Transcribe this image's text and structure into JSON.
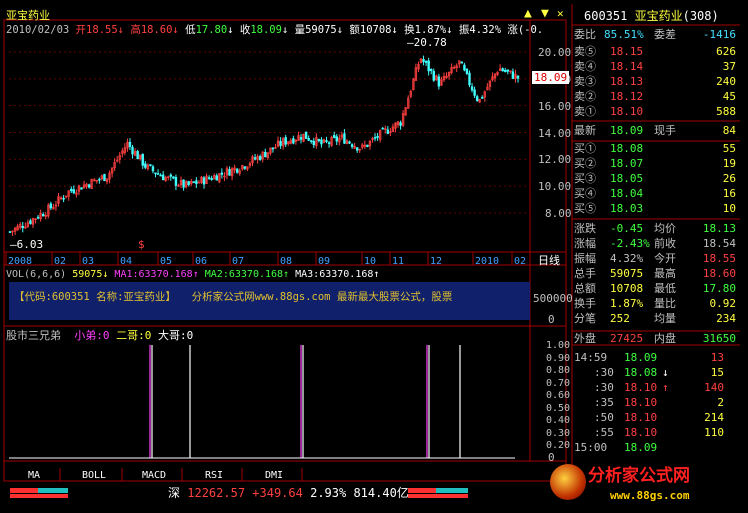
{
  "header": {
    "name": "亚宝药业",
    "date": "2010/02/03",
    "open_lbl": "开",
    "open": "18.55",
    "high_lbl": "高",
    "high": "18.60",
    "low_lbl": "低",
    "low": "17.80",
    "close_lbl": "收",
    "close": "18.09",
    "vol_lbl": "量",
    "vol": "59075",
    "amt_lbl": "额",
    "amt": "10708",
    "turn_lbl": "换",
    "turn": "1.87%",
    "amp_lbl": "振",
    "amp": "4.32%",
    "chg_lbl": "涨",
    "chg": "(-0."
  },
  "price_chart": {
    "y_ticks": [
      "20.00",
      "18.00",
      "16.00",
      "14.00",
      "12.00",
      "10.00",
      "8.00"
    ],
    "current_price": "18.09",
    "max_label": "20.78",
    "min_label": "6.03",
    "x_ticks": [
      "2008",
      "02",
      "03",
      "04",
      "05",
      "06",
      "07",
      "08",
      "09",
      "10",
      "11",
      "12",
      "2010",
      "02"
    ],
    "period": "日线",
    "marker": "$",
    "chart_data": {
      "type": "candlestick",
      "title": "亚宝药业",
      "period": "日线",
      "ylim": [
        6,
        21.5
      ],
      "max": 20.78,
      "min": 6.03,
      "last": 18.09,
      "trend_close": [
        6.6,
        7.4,
        8.3,
        9.6,
        10.2,
        10.8,
        13.2,
        11.4,
        10.6,
        10.0,
        10.5,
        11.0,
        11.6,
        12.4,
        13.3,
        13.8,
        13.1,
        13.6,
        12.8,
        13.9,
        14.8,
        19.6,
        17.6,
        19.2,
        16.3,
        18.8,
        18.09
      ]
    }
  },
  "vol_chart": {
    "title": "VOL(6,6,6)",
    "v": "59075",
    "ma1_lbl": "MA1:",
    "ma1": "63370.168",
    "ma2_lbl": "MA2:",
    "ma2": "63370.168",
    "ma3_lbl": "MA3:",
    "ma3": "63370.168",
    "tick": "500000",
    "zero": "0",
    "watermark": "【代码:600351 名称:亚宝药业】　　分析家公式网www.88gs.com 最新最大股票公式，股票"
  },
  "ind_chart": {
    "title": "股市三兄弟",
    "s1_lbl": "小弟:",
    "s1": "0",
    "s2_lbl": "二哥:",
    "s2": "0",
    "s3_lbl": "大哥:",
    "s3": "0",
    "y_ticks": [
      "1.00",
      "0.90",
      "0.80",
      "0.70",
      "0.60",
      "0.50",
      "0.40",
      "0.30",
      "0.20"
    ],
    "zero": "0"
  },
  "tabs": [
    "MA",
    "BOLL",
    "MACD",
    "RSI",
    "DMI"
  ],
  "status": {
    "market": "深",
    "index": "12262.57",
    "change": "+349.64",
    "pct": "2.93%",
    "amount": "814.40亿"
  },
  "right": {
    "code": "600351",
    "name": "亚宝药业",
    "num": "(308)",
    "ratio_lbl": "委比",
    "ratio": "85.51%",
    "diff_lbl": "委差",
    "diff": "-1416",
    "asks": [
      {
        "l": "卖⑤",
        "p": "18.15",
        "v": "626"
      },
      {
        "l": "卖④",
        "p": "18.14",
        "v": "37"
      },
      {
        "l": "卖③",
        "p": "18.13",
        "v": "240"
      },
      {
        "l": "卖②",
        "p": "18.12",
        "v": "45"
      },
      {
        "l": "卖①",
        "p": "18.10",
        "v": "588"
      }
    ],
    "last_lbl": "最新",
    "last": "18.09",
    "hand_lbl": "现手",
    "hand": "84",
    "bids": [
      {
        "l": "买①",
        "p": "18.08",
        "v": "55"
      },
      {
        "l": "买②",
        "p": "18.07",
        "v": "19"
      },
      {
        "l": "买③",
        "p": "18.05",
        "v": "26"
      },
      {
        "l": "买④",
        "p": "18.04",
        "v": "16"
      },
      {
        "l": "买⑤",
        "p": "18.03",
        "v": "10"
      }
    ],
    "stats": [
      {
        "a": "涨跌",
        "b": "-0.45",
        "c": "均价",
        "d": "18.13"
      },
      {
        "a": "涨幅",
        "b": "-2.43%",
        "c": "前收",
        "d": "18.54"
      },
      {
        "a": "振幅",
        "b": "4.32%",
        "c": "今开",
        "d": "18.55"
      },
      {
        "a": "总手",
        "b": "59075",
        "c": "最高",
        "d": "18.60"
      },
      {
        "a": "总额",
        "b": "10708",
        "c": "最低",
        "d": "17.80"
      },
      {
        "a": "换手",
        "b": "1.87%",
        "c": "量比",
        "d": "0.92"
      },
      {
        "a": "分笔",
        "b": "252",
        "c": "均量",
        "d": "234"
      }
    ],
    "outer_lbl": "外盘",
    "outer": "27425",
    "inner_lbl": "内盘",
    "inner": "31650",
    "ticks": [
      {
        "t": "14:59",
        "p": "18.09",
        "v": "13",
        "a": ""
      },
      {
        "t": ":30",
        "p": "18.08",
        "v": "15",
        "a": "↓"
      },
      {
        "t": ":30",
        "p": "18.10",
        "v": "140",
        "a": "↑"
      },
      {
        "t": ":35",
        "p": "18.10",
        "v": "2",
        "a": ""
      },
      {
        "t": ":50",
        "p": "18.10",
        "v": "214",
        "a": ""
      },
      {
        "t": ":55",
        "p": "18.10",
        "v": "110",
        "a": ""
      },
      {
        "t": "15:00",
        "p": "18.09",
        "v": "",
        "a": ""
      }
    ],
    "logo": "分析家公式网",
    "url": "www.88gs.com"
  }
}
